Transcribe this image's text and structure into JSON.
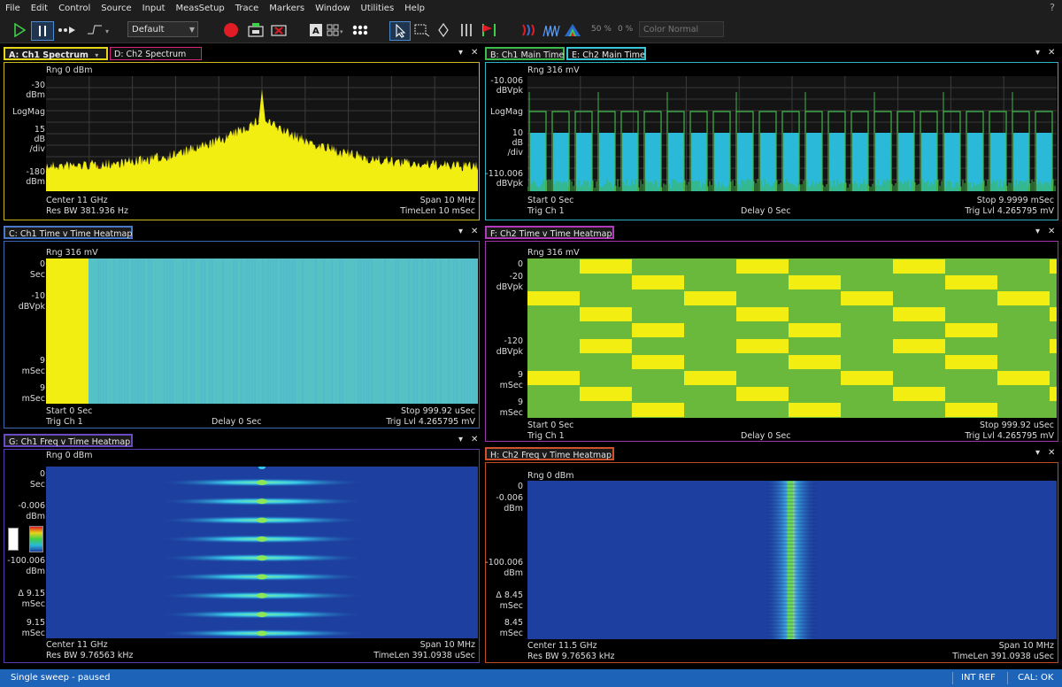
{
  "menu": [
    "File",
    "Edit",
    "Control",
    "Source",
    "Input",
    "MeasSetup",
    "Trace",
    "Markers",
    "Window",
    "Utilities",
    "Help"
  ],
  "help_glyph": "?",
  "toolbar": {
    "preset_value": "Default",
    "zoom_pct": "50 %",
    "zero_pct": "0 %",
    "color_mode": "Color Normal",
    "icons": [
      "play-icon",
      "pause-icon",
      "step-icon",
      "trigger-icon",
      "record-icon",
      "capture-icon",
      "stop-capture-icon",
      "text-label-icon",
      "grid-layout-icon",
      "cluster-icon",
      "pointer-icon",
      "zoom-box-icon",
      "marker-diamond-icon",
      "columns-icon",
      "marker-flag-icon",
      "spectrogram-icon",
      "waterfall-icon",
      "peak-icon"
    ]
  },
  "panes": {
    "A": {
      "tabs": [
        "A: Ch1 Spectrum",
        "D: Ch2 Spectrum"
      ],
      "tab_colors": [
        "#e6d61a",
        "#d6247a"
      ],
      "border": "#c9b81e",
      "top": "Rng 0 dBm",
      "y": [
        "-30",
        "dBm",
        "LogMag",
        "15",
        "dB",
        "/div",
        "-180",
        "dBm"
      ],
      "bl1": "Center 11 GHz",
      "bl2": "Res BW 381.936  Hz",
      "br1": "Span 10 MHz",
      "br2": "TimeLen 10 mSec"
    },
    "B": {
      "tabs": [
        "B: Ch1 Main Time",
        "E: Ch2 Main Time"
      ],
      "tab_colors": [
        "#3cba4c",
        "#36c6d6"
      ],
      "border": "#30b0c0",
      "top": "Rng 316 mV",
      "y": [
        "-10.006",
        "dBVpk",
        "LogMag",
        "10",
        "dB",
        "/div",
        "-110.006",
        "dBVpk"
      ],
      "bl1": "Start 0  Sec",
      "bl2": "Trig Ch 1",
      "bm2": "Delay 0  Sec",
      "br1": "Stop 9.9999 mSec",
      "br2": "Trig Lvl 4.265795 mV"
    },
    "C": {
      "tabs": [
        "C: Ch1 Time v Time Heatmap"
      ],
      "tab_colors": [
        "#4a78c8"
      ],
      "border": "#3c66b0",
      "top": "Rng 316 mV",
      "y": [
        "0",
        "Sec",
        "-10",
        "dBVpk",
        "9",
        "mSec",
        "9",
        "mSec"
      ],
      "bl1": "Start 0  Sec",
      "bl2": "Trig Ch 1",
      "bm2": "Delay 0  Sec",
      "br1": "Stop 999.92 uSec",
      "br2": "Trig Lvl 4.265795 mV"
    },
    "F": {
      "tabs": [
        "F: Ch2 Time v Time Heatmap"
      ],
      "tab_colors": [
        "#b03ab8"
      ],
      "border": "#a034a8",
      "top": "Rng 316 mV",
      "y": [
        "0",
        "-20",
        "dBVpk",
        "-120",
        "dBVpk",
        "9",
        "mSec",
        "9",
        "mSec"
      ],
      "bl1": "Start 0  Sec",
      "bl2": "Trig Ch 1",
      "bm2": "Delay 0  Sec",
      "br1": "Stop 999.92 uSec",
      "br2": "Trig Lvl 4.265795 mV"
    },
    "G": {
      "tabs": [
        "G: Ch1 Freq v Time Heatmap"
      ],
      "tab_colors": [
        "#6a4ac0"
      ],
      "border": "#5a3cb0",
      "top": "Rng 0 dBm",
      "y": [
        "0",
        "Sec",
        "-0.006",
        "dBm",
        "-100.006",
        "dBm",
        "Δ 9.15",
        "mSec",
        "9.15",
        "mSec"
      ],
      "bl1": "Center 11 GHz",
      "bl2": "Res BW 9.76563 kHz",
      "br1": "Span 10 MHz",
      "br2": "TimeLen 391.0938 uSec"
    },
    "H": {
      "tabs": [
        "H: Ch2 Freq v Time Heatmap"
      ],
      "tab_colors": [
        "#d0522a"
      ],
      "border": "#c04a24",
      "top": "Rng 0 dBm",
      "y": [
        "0",
        "-0.006",
        "dBm",
        "-100.006",
        "dBm",
        "Δ 8.45",
        "mSec",
        "8.45",
        "mSec"
      ],
      "bl1": "Center 11.5 GHz",
      "bl2": "Res BW 9.76563 kHz",
      "br1": "Span 10 MHz",
      "br2": "TimeLen 391.0938 uSec"
    }
  },
  "pane_controls": {
    "menu": "▾",
    "close": "✕"
  },
  "status": {
    "text": "Single sweep - paused",
    "int_ref": "INT REF",
    "cal": "CAL: OK"
  },
  "colors": {
    "ch1_trace": "#f2ee12",
    "ch2_trace": "#d4245c",
    "ch1_time": "#2ab9d8",
    "ch2_time": "#3fb64a",
    "heatmap_cyan": "#55c0c8",
    "heatmap_green": "#6ab83c",
    "heatmap_blue": "#1d3fa0"
  }
}
